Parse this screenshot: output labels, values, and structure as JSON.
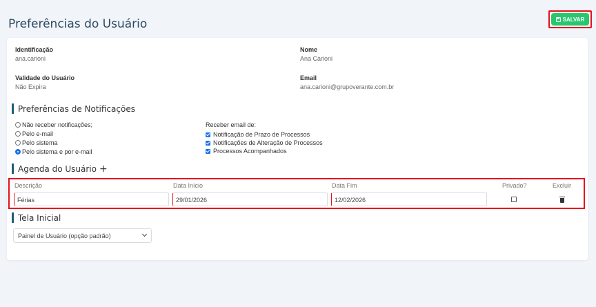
{
  "header": {
    "title": "Preferências do Usuário",
    "save_label": "SALVAR"
  },
  "user": {
    "identificacao_label": "Identificação",
    "identificacao_value": "ana.carioni",
    "nome_label": "Nome",
    "nome_value": "Ana Carioni",
    "validade_label": "Validade do Usuário",
    "validade_value": "Não Expira",
    "email_label": "Email",
    "email_value": "ana.carioni@grupoverante.com.br"
  },
  "notifications": {
    "title": "Preferências de Notificações",
    "options": [
      {
        "label": "Não receber notificações;",
        "selected": false
      },
      {
        "label": "Pelo e-mail",
        "selected": false
      },
      {
        "label": "Pelo sistema",
        "selected": false
      },
      {
        "label": "Pelo sistema e por e-mail",
        "selected": true
      }
    ],
    "email_head": "Receber email de:",
    "email_options": [
      {
        "label": "Notificação de Prazo de Processos",
        "checked": true
      },
      {
        "label": "Notificações de Alteração de Processos",
        "checked": true
      },
      {
        "label": "Processos Acompanhados",
        "checked": true
      }
    ]
  },
  "agenda": {
    "title": "Agenda do Usuário",
    "add_icon": "+",
    "columns": [
      "Descrição",
      "Data Início",
      "Data Fim",
      "Privado?",
      "Excluir"
    ],
    "row": {
      "descricao": "Férias",
      "inicio": "29/01/2026",
      "fim": "12/02/2026",
      "privado": false
    }
  },
  "tela_inicial": {
    "title": "Tela Inicial",
    "selected": "Painel de Usuário (opção padrão)"
  },
  "colors": {
    "accent": "#1f5c75",
    "save": "#28c76f",
    "highlight": "#e8101a"
  }
}
